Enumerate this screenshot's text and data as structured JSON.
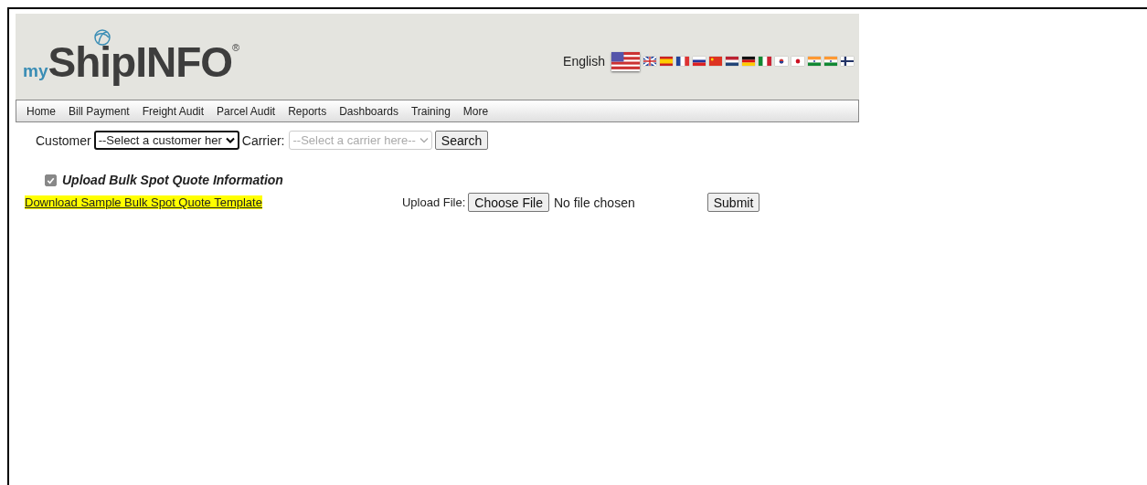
{
  "logo": {
    "prefix": "my",
    "name": "ShipINFO",
    "mark": "®"
  },
  "language": {
    "label": "English",
    "flags": [
      {
        "kind": "us",
        "selected": true
      },
      {
        "kind": "uk",
        "selected": false
      },
      {
        "kind": "es",
        "selected": false
      },
      {
        "kind": "fr",
        "selected": false
      },
      {
        "kind": "ru",
        "selected": false
      },
      {
        "kind": "cn",
        "selected": false
      },
      {
        "kind": "nl",
        "selected": false
      },
      {
        "kind": "de",
        "selected": false
      },
      {
        "kind": "it",
        "selected": false
      },
      {
        "kind": "kr",
        "selected": false
      },
      {
        "kind": "jp",
        "selected": false
      },
      {
        "kind": "te",
        "selected": false
      },
      {
        "kind": "in",
        "selected": false
      },
      {
        "kind": "fi",
        "selected": false
      }
    ]
  },
  "nav": [
    "Home",
    "Bill Payment",
    "Freight Audit",
    "Parcel Audit",
    "Reports",
    "Dashboards",
    "Training",
    "More"
  ],
  "filters": {
    "customer_label": "Customer",
    "customer_value": "--Select a customer her",
    "carrier_label": "Carrier:",
    "carrier_value": "--Select a carrier here--",
    "carrier_disabled": true,
    "search_button": "Search"
  },
  "upload": {
    "checkbox_label": "Upload Bulk Spot Quote Information",
    "checked": true,
    "template_link": "Download Sample Bulk Spot Quote Template",
    "file_label": "Upload File:",
    "choose_button": "Choose File",
    "file_status": "No file chosen",
    "submit_button": "Submit"
  }
}
